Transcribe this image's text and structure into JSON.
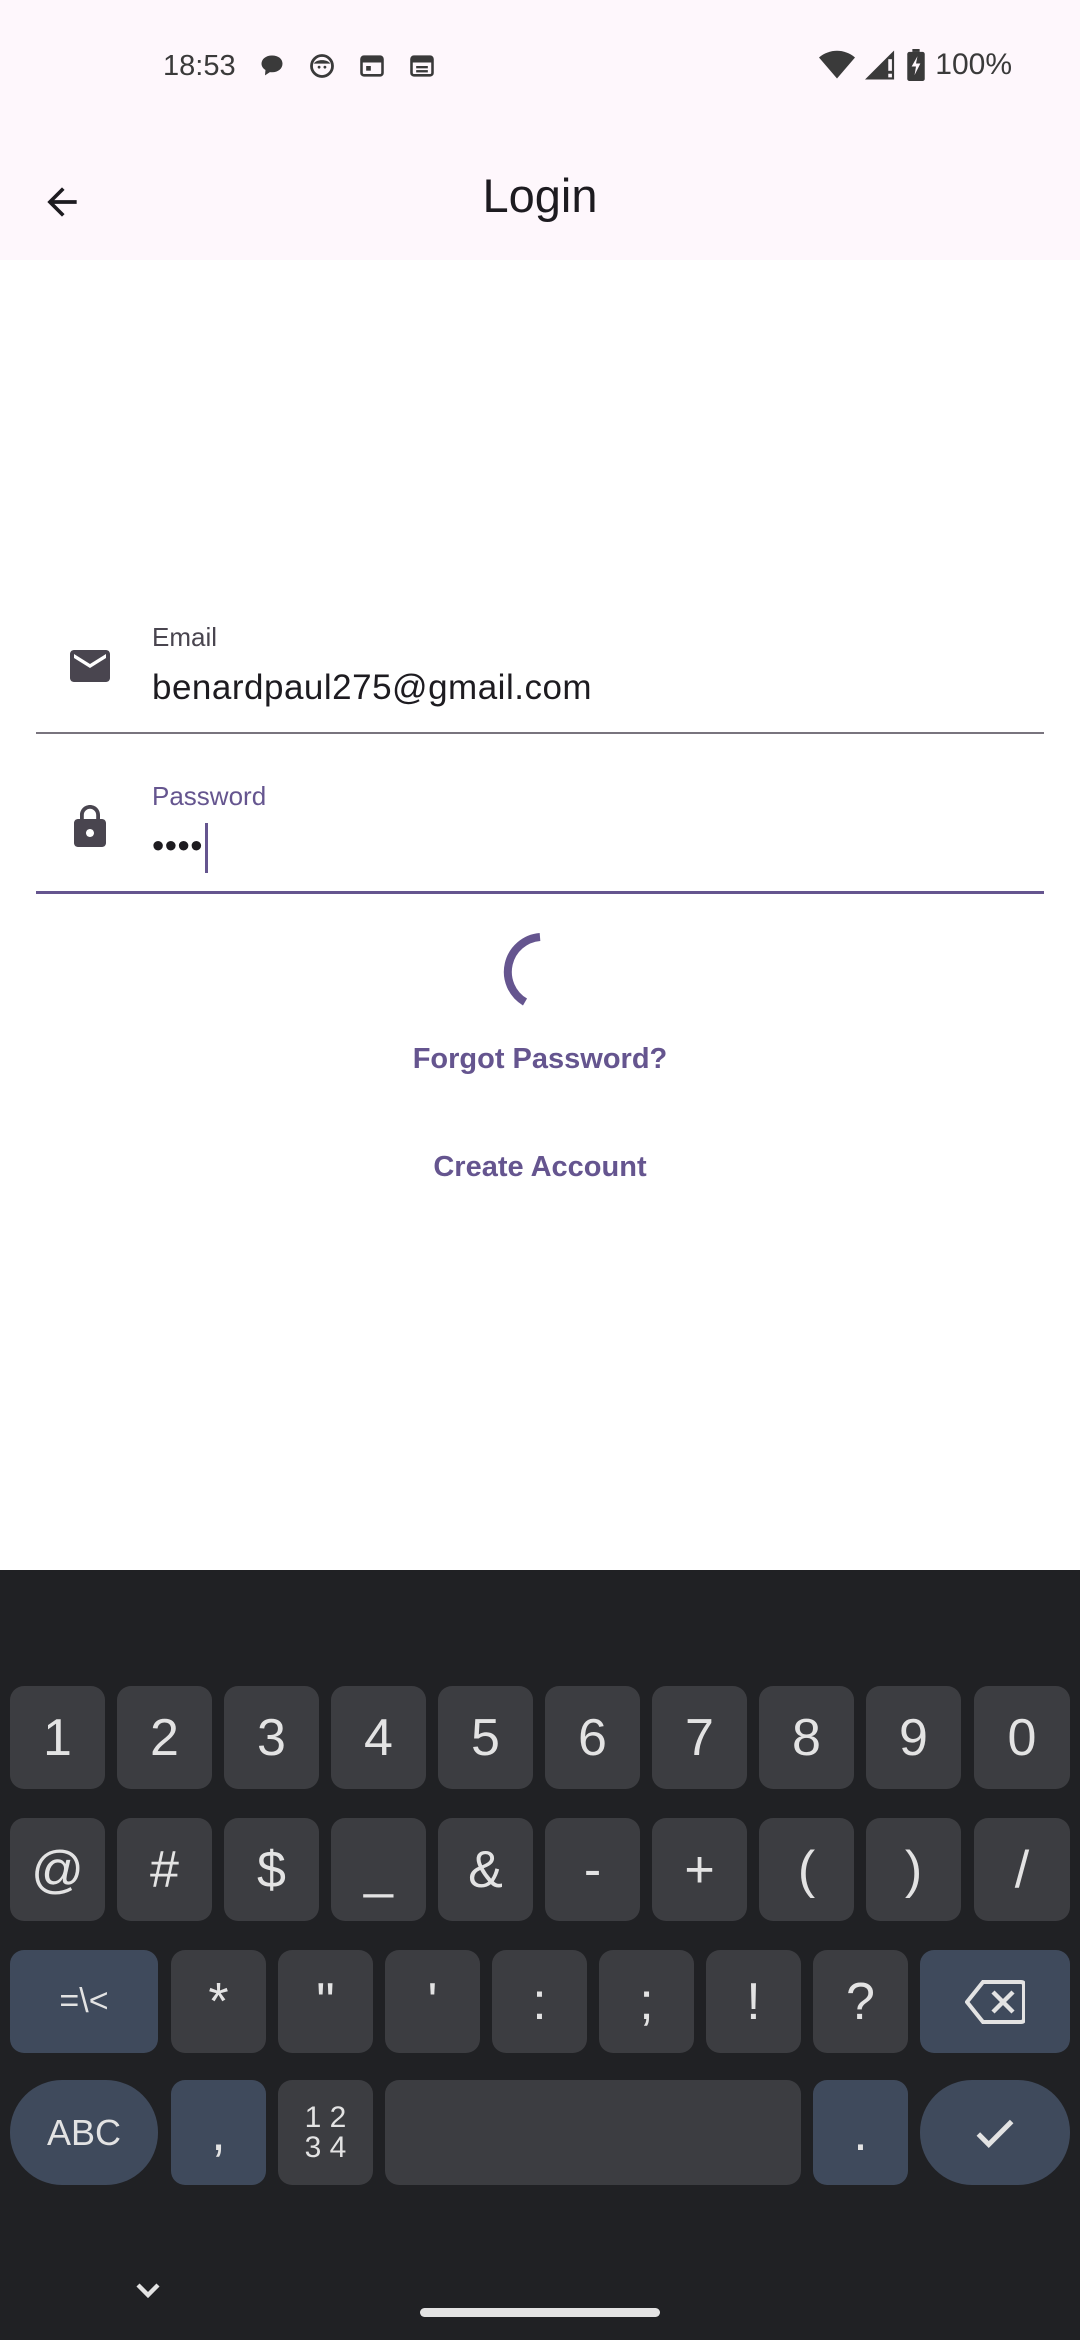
{
  "status_bar": {
    "time": "18:53",
    "left_icons": [
      "chat-bubble-icon",
      "face-icon",
      "calendar-icon",
      "calendar-icon"
    ],
    "right_icons": [
      "wifi-icon",
      "signal-icon",
      "battery-charging-icon"
    ],
    "battery": "100%"
  },
  "app_bar": {
    "title": "Login",
    "back_icon": "arrow-back-icon"
  },
  "form": {
    "email": {
      "label": "Email",
      "value": "benardpaul275@gmail.com",
      "icon": "mail-icon"
    },
    "password": {
      "label": "Password",
      "value": "••••",
      "icon": "lock-icon"
    },
    "loading": true,
    "forgot_password": "Forgot Password?",
    "create_account": "Create Account"
  },
  "colors": {
    "accent": "#65558f",
    "app_bar_bg": "#fef7fc",
    "keyboard_bg": "#202124",
    "key_bg": "#3c3d41",
    "function_key_bg": "#3f4a5c"
  },
  "keyboard": {
    "row1": [
      "1",
      "2",
      "3",
      "4",
      "5",
      "6",
      "7",
      "8",
      "9",
      "0"
    ],
    "row2": [
      "@",
      "#",
      "$",
      "_",
      "&",
      "-",
      "+",
      "(",
      ")",
      "/"
    ],
    "row3": [
      "=\\<",
      "*",
      "\"",
      "'",
      ":",
      ";",
      "!",
      "?"
    ],
    "row4": {
      "abc": "ABC",
      "comma": ",",
      "numpad_top": "1 2",
      "numpad_bottom": "3 4",
      "period": "."
    },
    "backspace_icon": "backspace-icon",
    "enter_icon": "checkmark-icon",
    "collapse_icon": "chevron-down-icon"
  }
}
